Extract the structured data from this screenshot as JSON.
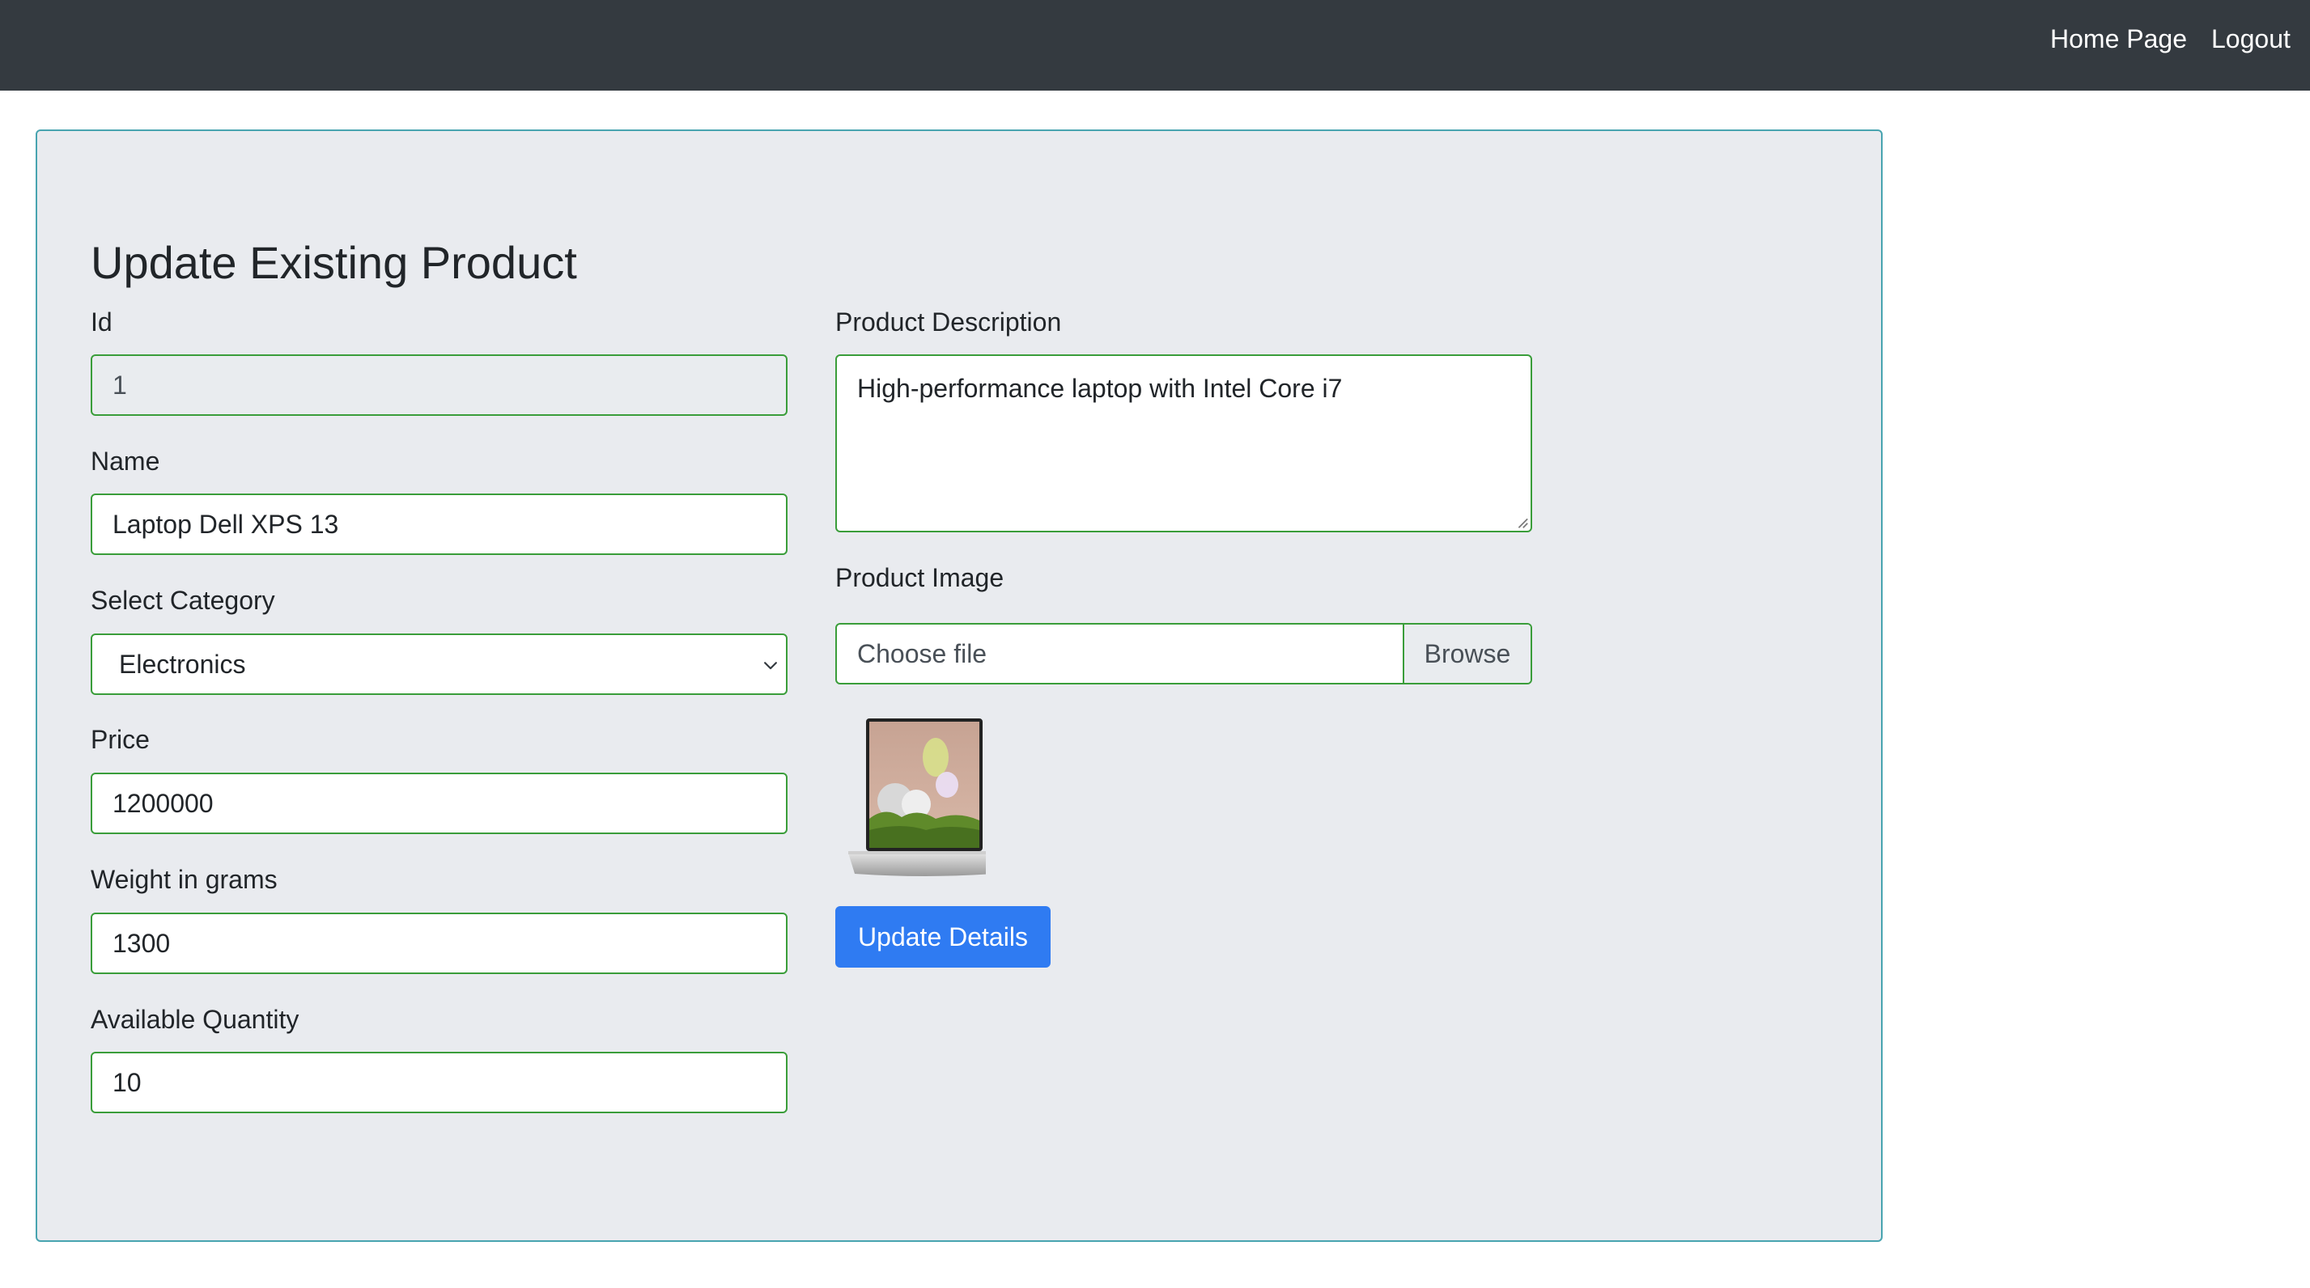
{
  "navbar": {
    "links": [
      {
        "label": "Home Page"
      },
      {
        "label": "Logout"
      }
    ],
    "background": "#343a40"
  },
  "form": {
    "title": "Update Existing Product",
    "id": {
      "label": "Id",
      "value": "1"
    },
    "name": {
      "label": "Name",
      "value": "Laptop Dell XPS 13"
    },
    "category": {
      "label": "Select Category",
      "selected": "Electronics"
    },
    "price": {
      "label": "Price",
      "value": "1200000"
    },
    "weight": {
      "label": "Weight in grams",
      "value": "1300"
    },
    "quantity": {
      "label": "Available Quantity",
      "value": "10"
    },
    "description": {
      "label": "Product Description",
      "value": "High-performance laptop with Intel Core i7"
    },
    "image": {
      "label": "Product Image",
      "placeholder": "Choose file",
      "browse_label": "Browse",
      "preview_icon": "laptop-product-image"
    },
    "submit_label": "Update Details"
  },
  "colors": {
    "card_background": "#e9ebef",
    "card_border": "#48a4b0",
    "field_border": "#3a9d3a",
    "primary_button": "#2f7bf2"
  }
}
